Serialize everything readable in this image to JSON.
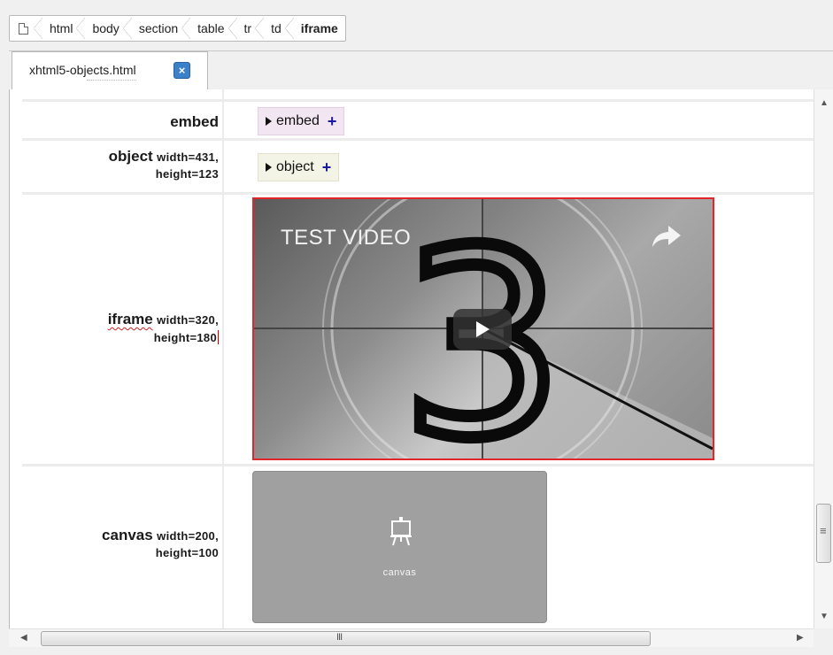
{
  "breadcrumb": {
    "root_icon": "document-icon",
    "items": [
      "html",
      "body",
      "section",
      "table",
      "tr",
      "td",
      "iframe"
    ]
  },
  "tab": {
    "label": "xhtml5-objects.html",
    "close_icon": "close-icon"
  },
  "rows": {
    "embed": {
      "tag": "embed",
      "collapsed_label": "embed"
    },
    "object": {
      "tag": "object",
      "attr1": "width=431,",
      "attr2": "height=123",
      "collapsed_label": "object"
    },
    "iframe": {
      "tag": "iframe",
      "attr1": "width=320,",
      "attr2": "height=180"
    },
    "canvas": {
      "tag": "canvas",
      "attr1": "width=200,",
      "attr2": "height=100",
      "placeholder_label": "canvas"
    }
  },
  "video": {
    "title": "TEST VIDEO",
    "countdown_digit": "3",
    "share_icon": "share-icon",
    "play_icon": "play-icon"
  },
  "colors": {
    "iframe_border": "#e0262a",
    "embed_bg": "#f2e6f2",
    "object_bg": "#f3f3e6",
    "tab_close": "#3b80c8"
  },
  "scrollbar": {
    "hgrip": "III"
  }
}
